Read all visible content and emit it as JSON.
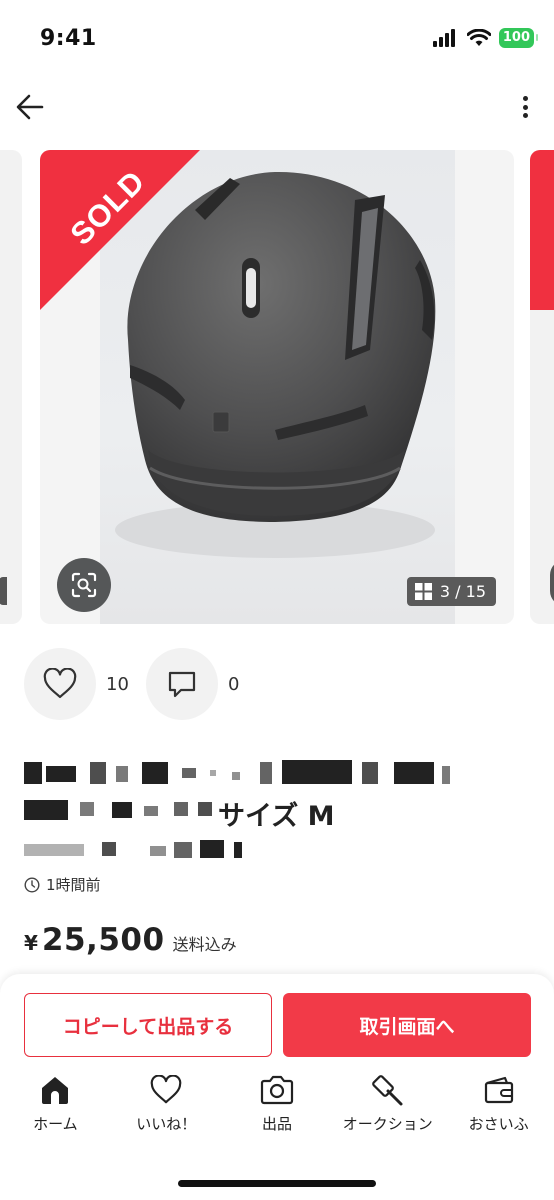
{
  "status_bar": {
    "time": "9:41",
    "battery": "100"
  },
  "gallery": {
    "sold_label": "SOLD",
    "page_indicator": "3 / 15"
  },
  "social": {
    "likes": "10",
    "comments": "0"
  },
  "item": {
    "title_visible_suffix": "サイズ M",
    "posted": "1時間前",
    "price_symbol": "¥",
    "price": "25,500",
    "shipping_note": "送料込み"
  },
  "actions": {
    "copy_listing": "コピーして出品する",
    "go_to_trade": "取引画面へ"
  },
  "tabs": [
    {
      "label": "ホーム",
      "icon": "home-icon"
    },
    {
      "label": "いいね！",
      "icon": "heart-icon"
    },
    {
      "label": "出品",
      "icon": "camera-icon"
    },
    {
      "label": "オークション",
      "icon": "gavel-icon"
    },
    {
      "label": "おさいふ",
      "icon": "wallet-icon"
    }
  ],
  "colors": {
    "accent": "#f23a48",
    "sold": "#f03040",
    "battery": "#32c759"
  }
}
